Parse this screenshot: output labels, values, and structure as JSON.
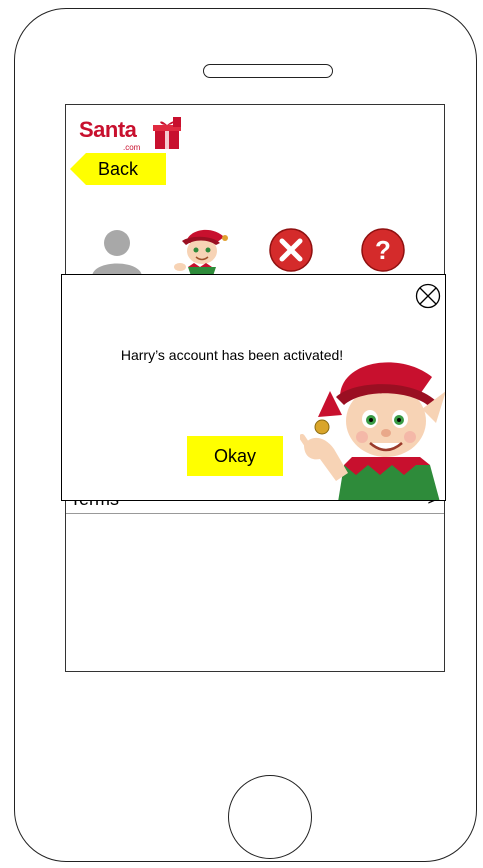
{
  "app": {
    "logo_text": "Santa",
    "logo_subtext": ".com",
    "back_label": "Back",
    "icons": [
      "avatar-placeholder-icon",
      "elf-icon",
      "cancel-icon",
      "help-icon"
    ],
    "terms_label": "Terms",
    "terms_chevron": ">"
  },
  "modal": {
    "message": "Harry’s account has been activated!",
    "okay_label": "Okay",
    "close_icon": "close-circle-x-icon"
  },
  "colors": {
    "accent_yellow": "#ffff00",
    "brand_red": "#c8102e",
    "cancel_red": "#d42b2b",
    "help_red": "#d42b2b"
  }
}
